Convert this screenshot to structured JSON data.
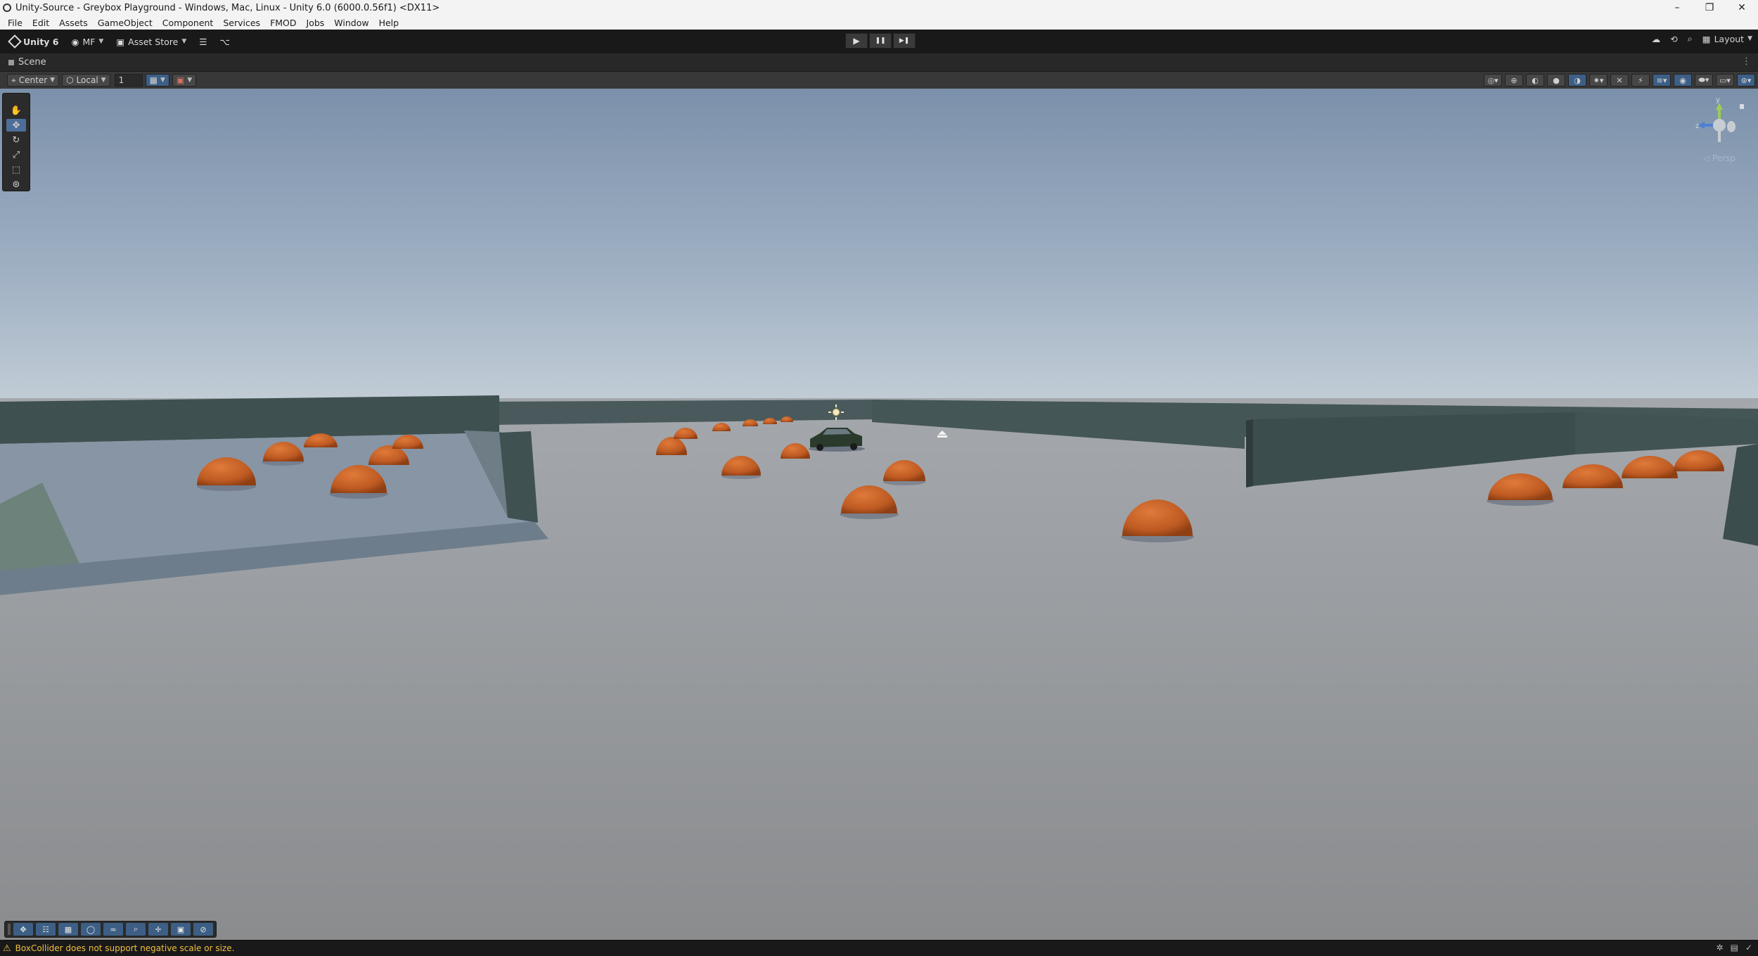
{
  "window": {
    "title": "Unity-Source - Greybox Playground - Windows, Mac, Linux - Unity 6.0 (6000.0.56f1) <DX11>",
    "minimize": "–",
    "maximize": "❐",
    "close": "✕"
  },
  "menu": [
    "File",
    "Edit",
    "Assets",
    "GameObject",
    "Component",
    "Services",
    "FMOD",
    "Jobs",
    "Window",
    "Help"
  ],
  "toolbar": {
    "unity_label": "Unity 6",
    "account_label": "MF",
    "asset_store_label": "Asset Store",
    "play": "▶",
    "pause": "❚❚",
    "step": "▶❚",
    "layout_label": "Layout"
  },
  "scene_tab": {
    "label": "Scene"
  },
  "scene_toolbar": {
    "pivot_label": "Center",
    "space_label": "Local",
    "grid_value": "1"
  },
  "gizmo": {
    "projection": "◁ Persp",
    "y_axis": "y",
    "z_axis": "z"
  },
  "status": {
    "message": "BoxCollider does not support negative scale or size."
  },
  "colors": {
    "accent": "#3d5f86",
    "warning": "#f0c040",
    "dome": "#c4622a",
    "floor": "#9ea1a6",
    "sky_top": "#7e93ad",
    "wall": "#3f5050"
  }
}
